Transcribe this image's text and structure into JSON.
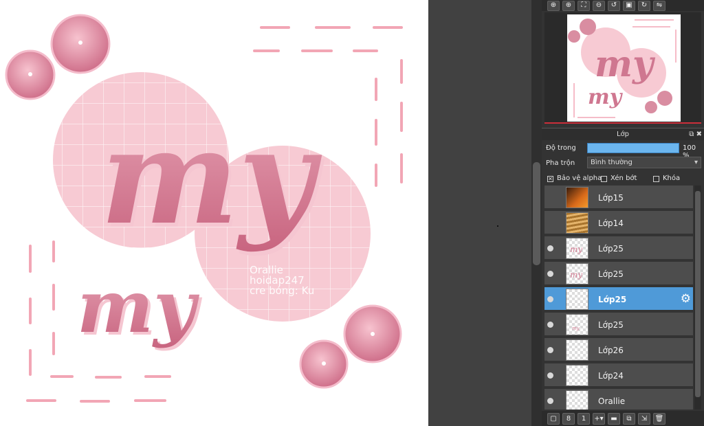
{
  "canvas": {
    "artwork_text_large": "my",
    "artwork_text_small": "my",
    "watermark_lines": [
      "Orallie",
      "hoidap247",
      "cre bóng: Ku"
    ],
    "colors": {
      "pink_dark": "#d77f96",
      "pink_light": "#f6c5cf",
      "dash": "#f0a7b4"
    }
  },
  "toolbar": {
    "icons": [
      "zoom-in-icon",
      "zoom-in-icon",
      "fit-icon",
      "zoom-out-icon",
      "rotate-left-icon",
      "fullscreen-icon",
      "rotate-right-icon",
      "flip-icon"
    ]
  },
  "layer_panel": {
    "title": "Lớp",
    "opacity_label": "Độ trong",
    "opacity_value": "100 %",
    "opacity_fraction": 1.0,
    "blend_label": "Pha trộn",
    "blend_value": "Bình thường",
    "protect_alpha": "Bảo vệ alpha",
    "clipping": "Xén bớt",
    "lock": "Khóa",
    "layers": [
      {
        "name": "Lớp15",
        "visible": false,
        "selected": false,
        "thumb": "orange-photo"
      },
      {
        "name": "Lớp14",
        "visible": false,
        "selected": false,
        "thumb": "blinds-photo"
      },
      {
        "name": "Lớp25",
        "visible": true,
        "selected": false,
        "thumb": "my-text"
      },
      {
        "name": "Lớp25",
        "visible": true,
        "selected": false,
        "thumb": "my-text"
      },
      {
        "name": "Lớp25",
        "visible": true,
        "selected": true,
        "thumb": "empty"
      },
      {
        "name": "Lớp25",
        "visible": true,
        "selected": false,
        "thumb": "small-text"
      },
      {
        "name": "Lớp26",
        "visible": true,
        "selected": false,
        "thumb": "empty"
      },
      {
        "name": "Lớp24",
        "visible": true,
        "selected": false,
        "thumb": "empty"
      },
      {
        "name": "Orallie",
        "visible": true,
        "selected": false,
        "thumb": "empty"
      }
    ]
  },
  "accent_color": "#4f9ad8"
}
